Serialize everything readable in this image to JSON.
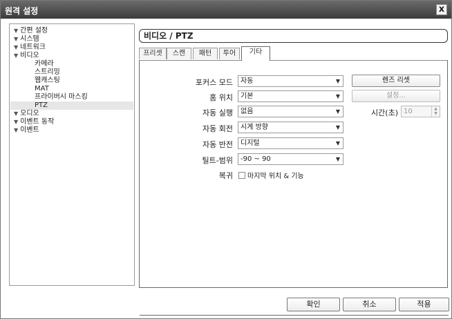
{
  "window": {
    "title": "원격 설정",
    "close_label": "x"
  },
  "tree": {
    "items": [
      {
        "label": "간편 설정"
      },
      {
        "label": "시스템"
      },
      {
        "label": "네트워크"
      },
      {
        "label": "비디오"
      },
      {
        "label": "카메라"
      },
      {
        "label": "스트리밍"
      },
      {
        "label": "웹캐스팅"
      },
      {
        "label": "MAT"
      },
      {
        "label": "프라이버시 마스킹"
      },
      {
        "label": "PTZ"
      },
      {
        "label": "오디오"
      },
      {
        "label": "이벤트 동작"
      },
      {
        "label": "이벤트"
      }
    ],
    "arrow": "▼"
  },
  "panel": {
    "header": "비디오 / PTZ",
    "tabs": [
      "프리셋",
      "스캔",
      "패턴",
      "투어",
      "기타"
    ],
    "active_tab": "기타"
  },
  "form": {
    "focus_mode": {
      "label": "포커스 모드",
      "value": "자동"
    },
    "home_position": {
      "label": "홈 위치",
      "value": "기본"
    },
    "auto_run": {
      "label": "자동 실행",
      "value": "없음"
    },
    "auto_rotate": {
      "label": "자동 회전",
      "value": "시계 방향"
    },
    "auto_flip": {
      "label": "자동 반전",
      "value": "디지털"
    },
    "tilt_range": {
      "label": "틸트-범위",
      "value": "-90 ~ 90"
    },
    "restore": {
      "label": "복귀",
      "checkbox_label": "마지막 위치 & 기능",
      "checked": false
    },
    "lens_reset_label": "렌즈 리셋",
    "settings_label": "설정...",
    "time_label": "시간(초)",
    "time_value": "10",
    "dropdown_arrow": "▼"
  },
  "footer": {
    "ok": "확인",
    "cancel": "취소",
    "apply": "적용"
  }
}
